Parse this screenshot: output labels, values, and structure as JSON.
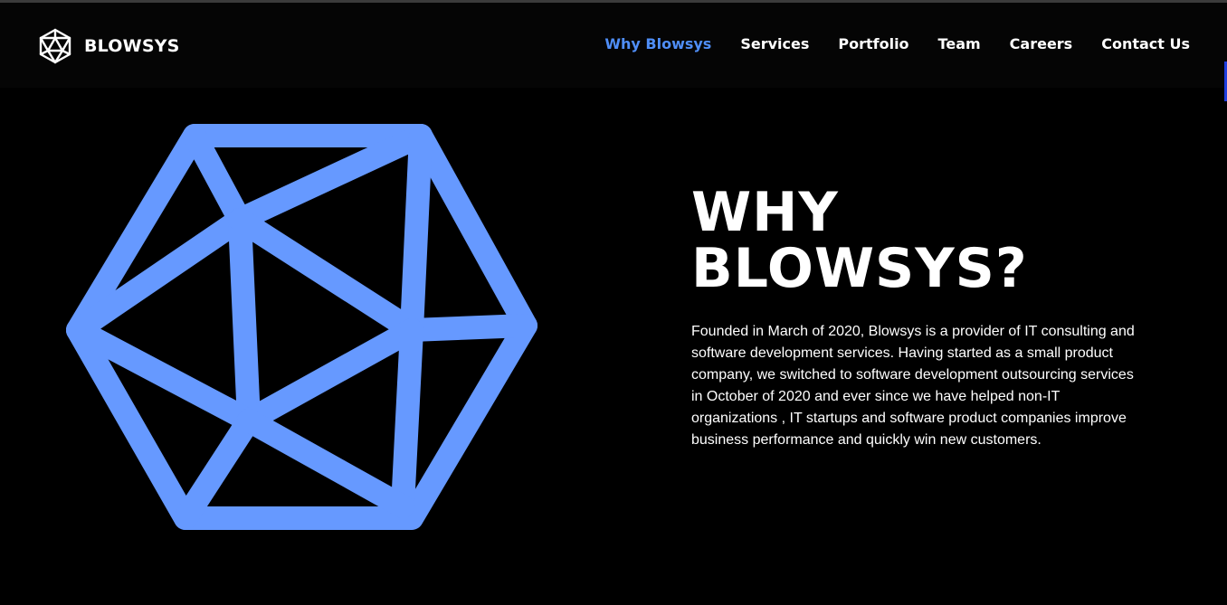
{
  "header": {
    "logo_text": "BLOWSYS",
    "nav": [
      {
        "label": "Why Blowsys",
        "active": true
      },
      {
        "label": "Services",
        "active": false
      },
      {
        "label": "Portfolio",
        "active": false
      },
      {
        "label": "Team",
        "active": false
      },
      {
        "label": "Careers",
        "active": false
      },
      {
        "label": "Contact Us",
        "active": false
      }
    ]
  },
  "hero": {
    "title_line1": "WHY",
    "title_line2": "BLOWSYS?",
    "description": "Founded in March of 2020, Blowsys is a provider of IT consulting and software development services. Having started as a small product company, we switched to software development outsourcing services in October of 2020 and ever since we have helped non-IT organizations , IT startups and software product companies improve business performance and quickly win new customers.",
    "graphic_icon": "polyhedron-icon"
  },
  "colors": {
    "accent": "#4f8ef7",
    "graphic": "#6699ff",
    "background": "#000000",
    "header_background": "#050505",
    "text": "#ffffff"
  }
}
